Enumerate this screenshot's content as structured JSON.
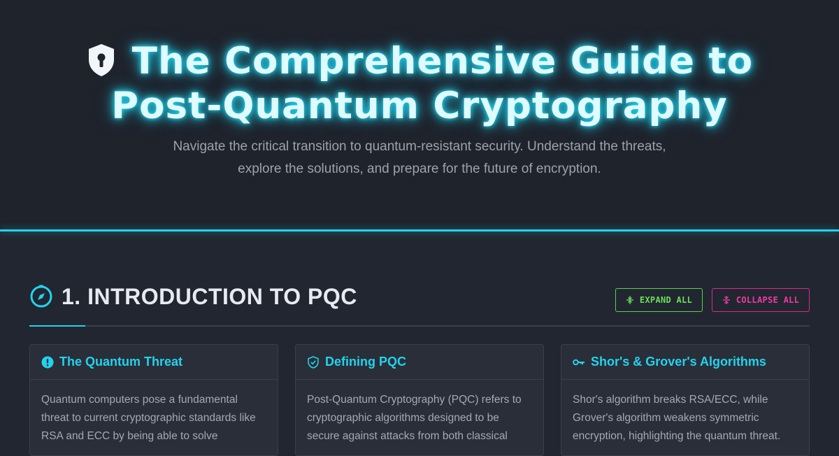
{
  "hero": {
    "title": "The Comprehensive Guide to Post-Quantum Cryptography",
    "icon": "shield-keyhole-icon",
    "subtitle": "Navigate the critical transition to quantum-resistant security. Understand the threats, explore the solutions, and prepare for the future of encryption."
  },
  "section": {
    "title": "1. INTRODUCTION TO PQC",
    "icon": "compass-icon",
    "expand_label": "EXPAND ALL",
    "collapse_label": "COLLAPSE ALL"
  },
  "cards": [
    {
      "title": "The Quantum Threat",
      "icon": "alert-circle-icon",
      "body": "Quantum computers pose a fundamental threat to current cryptographic standards like RSA and ECC by being able to solve"
    },
    {
      "title": "Defining PQC",
      "icon": "shield-check-icon",
      "body": "Post-Quantum Cryptography (PQC) refers to cryptographic algorithms designed to be secure against attacks from both classical"
    },
    {
      "title": "Shor's & Grover's Algorithms",
      "icon": "key-icon",
      "body": "Shor's algorithm breaks RSA/ECC, while Grover's algorithm weakens symmetric encryption, highlighting the quantum threat."
    }
  ],
  "colors": {
    "accent": "#22d3ee",
    "expand": "#56d44a",
    "collapse": "#e02594",
    "background": "#222630"
  }
}
